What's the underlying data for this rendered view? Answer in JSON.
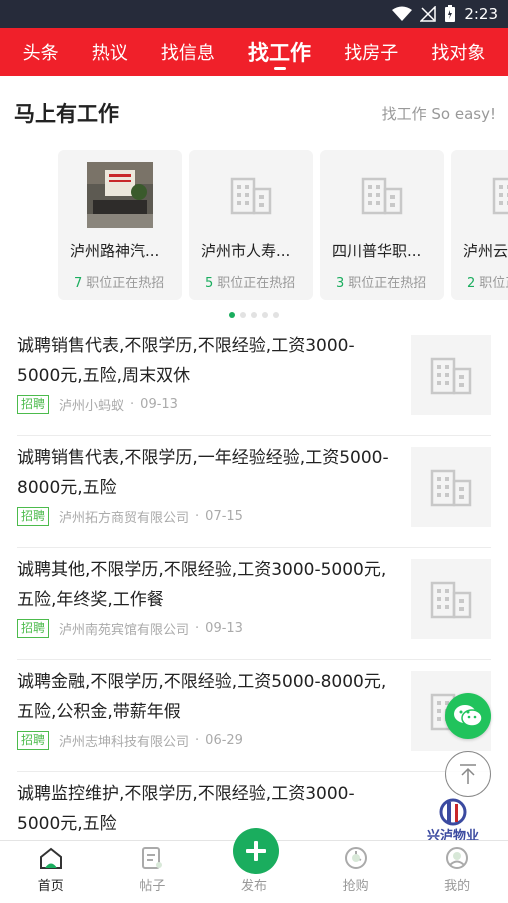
{
  "status_bar": {
    "time": "2:23"
  },
  "top_tabs": [
    "头条",
    "热议",
    "找信息",
    "找工作",
    "找房子",
    "找对象"
  ],
  "active_tab": "找工作",
  "section": {
    "title": "马上有工作",
    "subtitle": "找工作 So easy!"
  },
  "companies": [
    {
      "name": "泸州路神汽...",
      "count": "7",
      "suffix": "职位正在热招",
      "has_photo": true
    },
    {
      "name": "泸州市人寿...",
      "count": "5",
      "suffix": "职位正在热招",
      "has_photo": false
    },
    {
      "name": "四川普华职...",
      "count": "3",
      "suffix": "职位正在热招",
      "has_photo": false
    },
    {
      "name": "泸州云",
      "count": "2",
      "suffix": "职位正",
      "has_photo": false
    }
  ],
  "carousel_dots": {
    "count": 5,
    "active": 0
  },
  "jobs": [
    {
      "title": "诚聘销售代表,不限学历,不限经验,工资3000-5000元,五险,周末双休",
      "tag": "招聘",
      "company": "泸州小蚂蚁",
      "date": "09-13"
    },
    {
      "title": "诚聘销售代表,不限学历,一年经验经验,工资5000-8000元,五险",
      "tag": "招聘",
      "company": "泸州拓方商贸有限公司",
      "date": "07-15"
    },
    {
      "title": "诚聘其他,不限学历,不限经验,工资3000-5000元,五险,年终奖,工作餐",
      "tag": "招聘",
      "company": "泸州南苑宾馆有限公司",
      "date": "09-13"
    },
    {
      "title": "诚聘金融,不限学历,不限经验,工资5000-8000元,五险,公积金,带薪年假",
      "tag": "招聘",
      "company": "泸州志坤科技有限公司",
      "date": "06-29"
    },
    {
      "title": "诚聘监控维护,不限学历,不限经验,工资3000-5000元,五险",
      "tag": "招聘",
      "company": "",
      "date": ""
    }
  ],
  "watermark_text": "兴泸物业",
  "bottom_nav": [
    {
      "label": "首页",
      "icon": "home-icon"
    },
    {
      "label": "帖子",
      "icon": "post-icon"
    },
    {
      "label": "发布",
      "icon": "plus-icon"
    },
    {
      "label": "抢购",
      "icon": "flash-sale-icon"
    },
    {
      "label": "我的",
      "icon": "profile-icon"
    }
  ],
  "colors": {
    "brand_red": "#f0202a",
    "accent_green": "#1aad5e",
    "tag_green": "#4cbb4c",
    "status_bg": "#262b3a"
  }
}
